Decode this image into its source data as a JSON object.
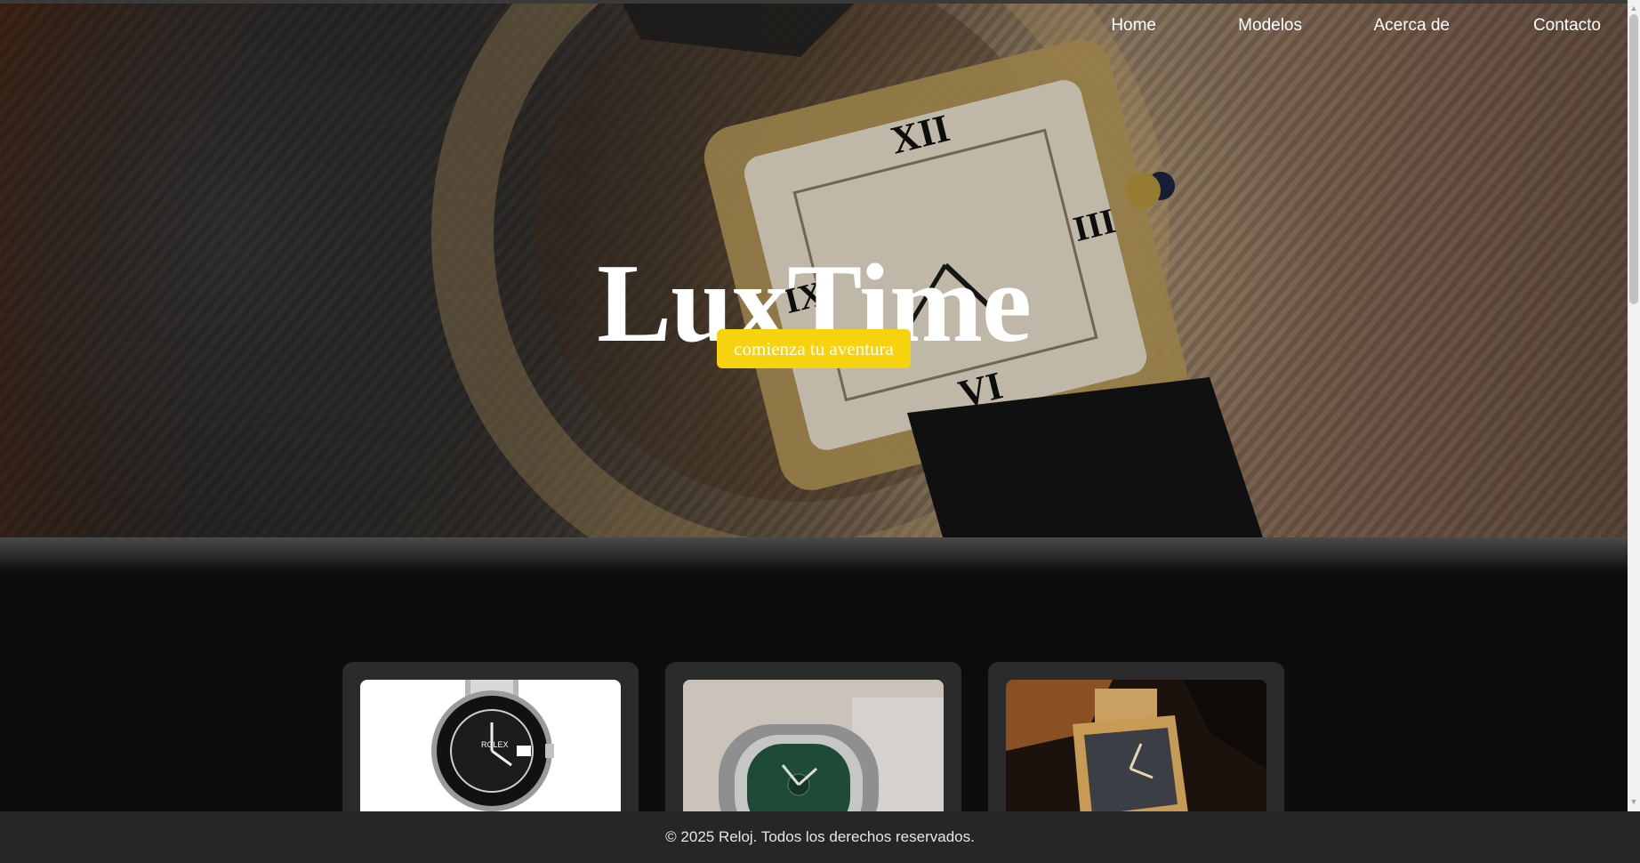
{
  "nav": {
    "items": [
      {
        "label": "Home"
      },
      {
        "label": "Modelos"
      },
      {
        "label": "Acerca de"
      },
      {
        "label": "Contacto"
      }
    ]
  },
  "hero": {
    "title": "LuxTime",
    "cta_label": "comienza tu aventura"
  },
  "colors": {
    "accent": "#f7d20f",
    "page_bg": "#0c0c0c",
    "card_bg": "#2b2b2b",
    "footer_bg": "#262626"
  },
  "cards": [
    {
      "image": "rolex-submariner-photo"
    },
    {
      "image": "patek-nautilus-green-photo"
    },
    {
      "image": "audemars-royal-oak-gold-photo"
    }
  ],
  "footer": {
    "text": "© 2025 Reloj. Todos los derechos reservados."
  }
}
